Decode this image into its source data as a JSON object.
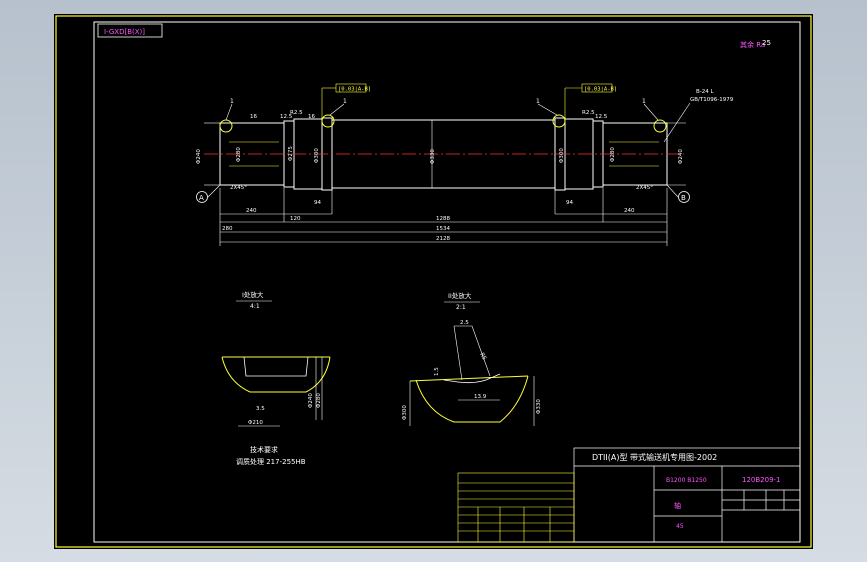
{
  "drawing": {
    "corner_tag": "I-GXD[B(X)]",
    "roughness_note": "其余 Ra",
    "roughness_val": "25",
    "tol_left": "[0.03|A-B]",
    "tol_right": "[0.03|A-B]",
    "chamfer_left": "2X45°",
    "chamfer_right": "2X45°",
    "keyway_label": "B-24 L",
    "keyway_std": "GB/T1096-1979",
    "datum_a": "A",
    "datum_b": "B",
    "balloon": "1",
    "dims": {
      "d1": "Φ240",
      "d2": "Φ280",
      "d3": "Φ275",
      "d4": "Φ300",
      "d5": "Φ330",
      "d6": "Φ300",
      "d7": "Φ280",
      "d8": "Φ240",
      "l1": "240",
      "l2": "120",
      "l3": "94",
      "l4": "1288",
      "l5": "94",
      "l6": "240",
      "l7": "280",
      "l8": "1534",
      "l9": "2128",
      "small1": "16",
      "small2": "R2.5",
      "small3": "12.5",
      "small4": "16",
      "small5": "R2.5",
      "small6": "12.5"
    },
    "sectionA": {
      "title": "I处放大",
      "scale": "4:1",
      "dim1": "Φ240",
      "dim2": "Φ280",
      "dim3": "3.5",
      "dim4": "Φ210"
    },
    "sectionB": {
      "title": "II处放大",
      "scale": "2:1",
      "dim1": "2.5",
      "dim2": "R5",
      "dim3": "1.5",
      "dim4": "Φ300",
      "dim5": "Φ330",
      "dim6": "13.9"
    },
    "tech_title": "技术要求",
    "tech_line": "调质处理 217-255HB"
  },
  "title_block": {
    "project": "DTII(A)型 带式输送机专用图-2002",
    "part_code": "B1200 B1250",
    "drawing_no": "120B209-1",
    "part_name": "轴",
    "material": "45"
  }
}
